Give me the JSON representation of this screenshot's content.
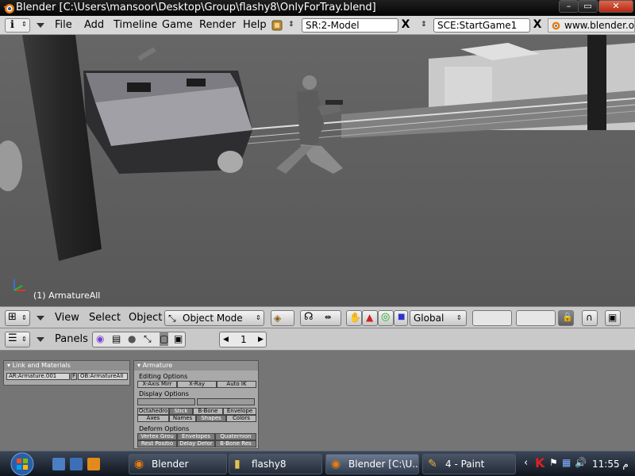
{
  "window": {
    "title": "Blender [C:\\Users\\mansoor\\Desktop\\Group\\flashy8\\OnlyForTray.blend]",
    "controls": [
      "–",
      "▭",
      "✕"
    ]
  },
  "menubar": {
    "menus": [
      "File",
      "Add",
      "Timeline",
      "Game",
      "Render",
      "Help"
    ],
    "screen_field": "SR:2-Model",
    "scene_field": "SCE:StartGame1",
    "url": "www.blender.or",
    "close_label": "X"
  },
  "viewport": {
    "status_text": "(1) ArmatureAll"
  },
  "header3d": {
    "menus": [
      "View",
      "Select",
      "Object"
    ],
    "mode": "Object Mode",
    "orientation": "Global"
  },
  "buttons_header": {
    "panels_label": "Panels",
    "frame": "1"
  },
  "link_panel": {
    "title": "Link and Materials",
    "ar_field": "AR:Armature.001",
    "f_label": "F",
    "ob_field": "OB:ArmatureAll"
  },
  "armature_panel": {
    "title": "Armature",
    "editing_label": "Editing Options",
    "editing_buttons": [
      "X-Axis Mirr",
      "X-Ray",
      "Auto IK"
    ],
    "display_label": "Display Options",
    "display_row1": [
      "Octahedro",
      "Stick",
      "B-Bone",
      "Envelope"
    ],
    "display_row2": [
      "Axes",
      "Names",
      "Shapes",
      "Colors"
    ],
    "deform_label": "Deform Options",
    "deform_row1": [
      "Vertex Grou",
      "Envelopes",
      "Quaternion"
    ],
    "deform_row2": [
      "Rest Positio",
      "Delay Defor",
      "B-Bone Res"
    ]
  },
  "taskbar": {
    "tasks": [
      "Blender",
      "flashy8",
      "Blender [C:\\U...",
      "4 - Paint"
    ],
    "clock": "11:55 م"
  },
  "colors": {
    "titlebar": "#0a0a0a",
    "menubar": "#d8d8d8",
    "viewport": "#5d5d5d",
    "panel": "#a9a9a9",
    "taskbar": "#1c2330",
    "blender_orange": "#e87d0d"
  }
}
